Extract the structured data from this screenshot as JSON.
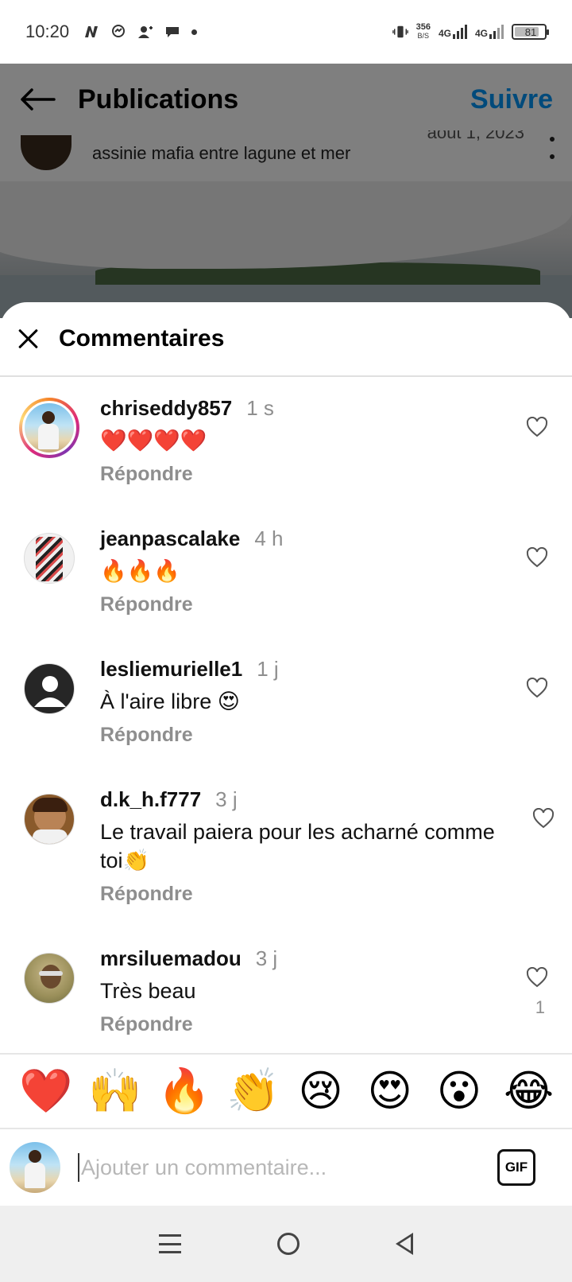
{
  "status_bar": {
    "time": "10:20",
    "speed_value": "356",
    "speed_unit": "B/S",
    "network_1": "4G",
    "network_2": "4G",
    "battery": "81"
  },
  "top_bar": {
    "title": "Publications",
    "follow_label": "Suivre"
  },
  "post": {
    "caption": "assinie mafia entre lagune et mer",
    "date": "août 1, 2023"
  },
  "comments_sheet": {
    "title": "Commentaires",
    "reply_label": "Répondre",
    "comments": [
      {
        "username": "chriseddy857",
        "time": "1 s",
        "text": "❤️❤️❤️❤️",
        "likes": ""
      },
      {
        "username": "jeanpascalake",
        "time": "4 h",
        "text": "🔥🔥🔥",
        "likes": ""
      },
      {
        "username": "lesliemurielle1",
        "time": "1 j",
        "text": "À l'aire libre 😍",
        "likes": ""
      },
      {
        "username": "d.k_h.f777",
        "time": "3 j",
        "text": "Le travail paiera pour les acharné comme toi👏",
        "likes": ""
      },
      {
        "username": "mrsiluemadou",
        "time": "3 j",
        "text": "Très beau",
        "likes": "1"
      }
    ]
  },
  "quick_emojis": [
    "❤️",
    "🙌",
    "🔥",
    "👏",
    "😢",
    "😍",
    "😮",
    "😂"
  ],
  "comment_input": {
    "placeholder": "Ajouter un commentaire...",
    "gif_label": "GIF"
  },
  "colors": {
    "accent": "#0095f6",
    "muted_text": "#8e8e8e",
    "heart_red": "#ed1c24"
  }
}
